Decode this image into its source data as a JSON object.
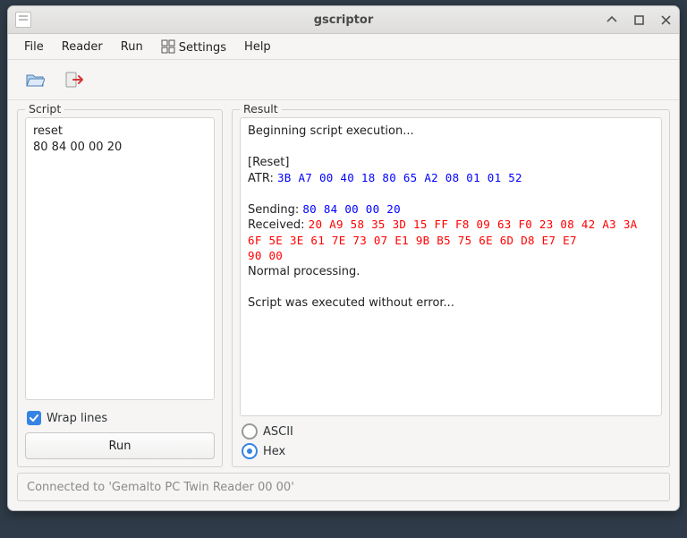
{
  "window": {
    "title": "gscriptor"
  },
  "menu": {
    "file": "File",
    "reader": "Reader",
    "run": "Run",
    "settings": "Settings",
    "help": "Help"
  },
  "panels": {
    "script_label": "Script",
    "result_label": "Result"
  },
  "script": {
    "line1": "reset",
    "line2": "80 84 00 00 20"
  },
  "wrap_lines_label": "Wrap lines",
  "run_button": "Run",
  "result": {
    "begin": "Beginning script execution...",
    "reset_tag": "[Reset]",
    "atr_label": "ATR: ",
    "atr_hex": "3B A7 00 40 18 80 65 A2 08 01 01 52",
    "sending_label": "Sending: ",
    "sending_hex": "80 84 00 00 20",
    "received_label": "Received: ",
    "received_hex1": "20 A9 58 35 3D 15 FF F8 09 63 F0 23 08 42 A3 3A",
    "received_hex2": "6F 5E 3E 61 7E 73 07 E1 9B B5 75 6E 6D D8 E7 E7",
    "received_sw": "90 00",
    "normal": "Normal processing.",
    "done": "Script was executed without error..."
  },
  "radio": {
    "ascii": "ASCII",
    "hex": "Hex"
  },
  "status": "Connected to 'Gemalto PC Twin Reader 00 00'"
}
